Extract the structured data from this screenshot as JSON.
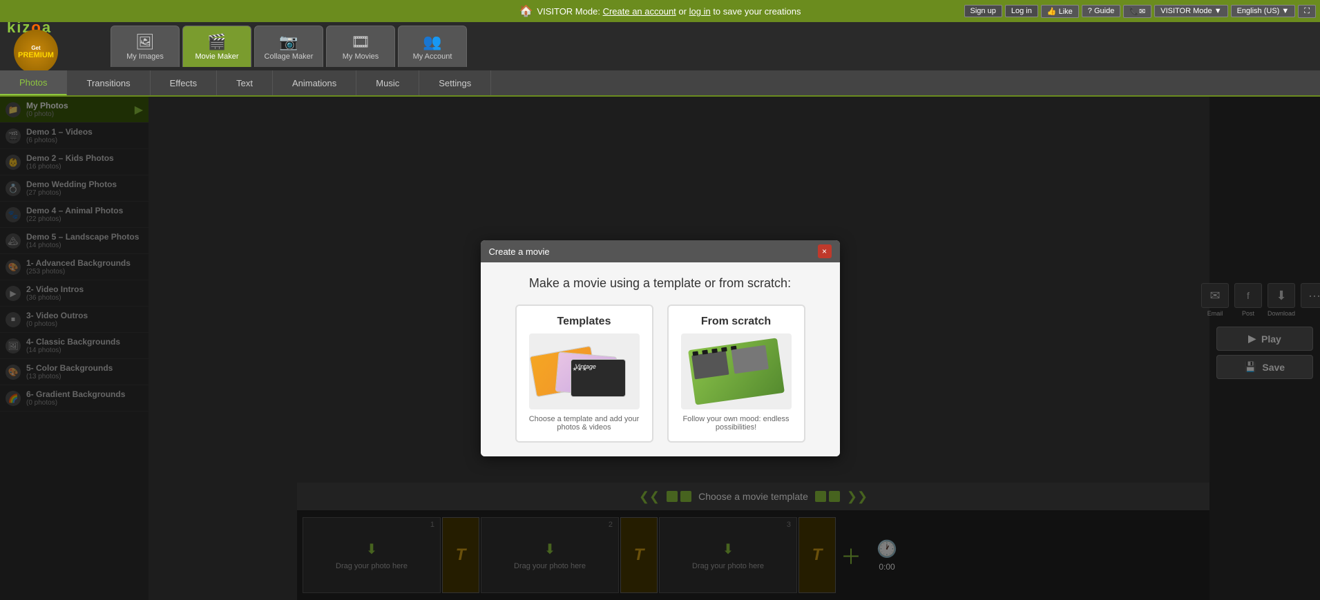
{
  "topbar": {
    "visitor_msg": "VISITOR Mode:",
    "create_account": "Create an account",
    "or": "or",
    "log_in": "log in",
    "save_msg": "to save your creations",
    "signup_label": "Sign up",
    "login_label": "Log in",
    "fb_like": "Like",
    "guide": "Guide",
    "visitor_mode": "VISITOR Mode",
    "language": "English (US)"
  },
  "header": {
    "logo": "kizoa",
    "premium": "PREMIUM",
    "get": "Get",
    "nav_tabs": [
      {
        "id": "my-images",
        "label": "My Images",
        "icon": "🖼"
      },
      {
        "id": "movie-maker",
        "label": "Movie Maker",
        "icon": "🎬",
        "active": true
      },
      {
        "id": "collage-maker",
        "label": "Collage Maker",
        "icon": "📷"
      },
      {
        "id": "my-movies",
        "label": "My Movies",
        "icon": "🎞"
      },
      {
        "id": "my-account",
        "label": "My Account",
        "icon": "👥"
      }
    ]
  },
  "toolbar": {
    "tabs": [
      {
        "id": "photos",
        "label": "Photos",
        "active": true
      },
      {
        "id": "transitions",
        "label": "Transitions"
      },
      {
        "id": "effects",
        "label": "Effects"
      },
      {
        "id": "text",
        "label": "Text"
      },
      {
        "id": "animations",
        "label": "Animations"
      },
      {
        "id": "music",
        "label": "Music"
      },
      {
        "id": "settings",
        "label": "Settings"
      }
    ]
  },
  "sidebar": {
    "items": [
      {
        "id": "my-photos",
        "name": "My Photos",
        "count": "(0 photo)",
        "active": true,
        "arrow": true
      },
      {
        "id": "demo1",
        "name": "Demo 1 – Videos",
        "count": "(6 photos)"
      },
      {
        "id": "demo2",
        "name": "Demo 2 – Kids Photos",
        "count": "(16 photos)"
      },
      {
        "id": "demo3",
        "name": "Demo Wedding Photos",
        "count": "(27 photos)"
      },
      {
        "id": "demo4",
        "name": "Demo 4 – Animal Photos",
        "count": "(22 photos)"
      },
      {
        "id": "demo5",
        "name": "Demo 5 – Landscape Photos",
        "count": "(14 photos)"
      },
      {
        "id": "adv-bg",
        "name": "1- Advanced Backgrounds",
        "count": "(253 photos)"
      },
      {
        "id": "vid-intros",
        "name": "2- Video Intros",
        "count": "(36 photos)"
      },
      {
        "id": "vid-outros",
        "name": "3- Video Outros",
        "count": "(0 photos)"
      },
      {
        "id": "classic-bg",
        "name": "4- Classic Backgrounds",
        "count": "(14 photos)"
      },
      {
        "id": "color-bg",
        "name": "5- Color Backgrounds",
        "count": "(13 photos)"
      },
      {
        "id": "grad-bg",
        "name": "6- Gradient Backgrounds",
        "count": "(0 photos)"
      }
    ]
  },
  "timeline": {
    "slots": [
      {
        "num": 1,
        "label": "Drag your photo here"
      },
      {
        "num": 2,
        "label": "Drag your photo here"
      },
      {
        "num": 3,
        "label": "Drag your photo here"
      }
    ],
    "timer": "0:00"
  },
  "template_bar": {
    "label": "Choose a movie template"
  },
  "right_panel": {
    "email_label": "Email",
    "post_label": "Post",
    "download_label": "Download",
    "play_label": "Play",
    "save_label": "Save"
  },
  "modal": {
    "title": "Create a movie",
    "heading": "Make a movie using a template or from scratch:",
    "close_label": "×",
    "templates_title": "Templates",
    "templates_desc": "Choose a template and add your photos & videos",
    "scratch_title": "From scratch",
    "scratch_desc": "Follow your own mood: endless possibilities!"
  }
}
